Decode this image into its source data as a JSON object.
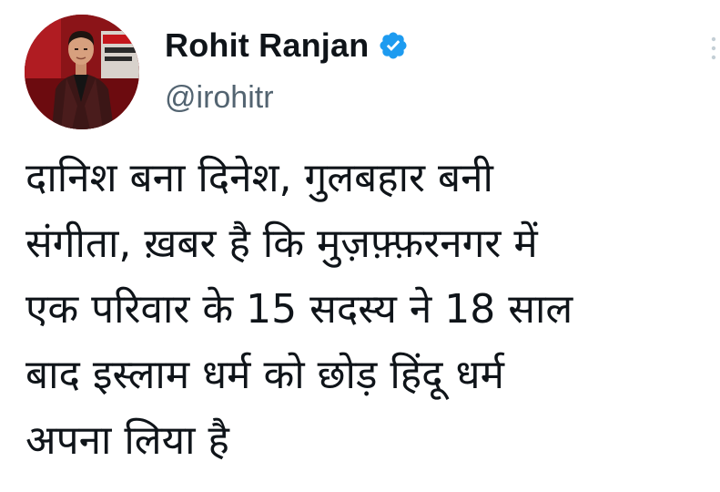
{
  "tweet": {
    "author": {
      "display_name": "Rohit Ranjan",
      "handle": "@irohitr",
      "verified": true
    },
    "text": "दानिश बना दिनेश, गुलबहार बनी\nसंगीता, ख़बर है कि मुज़फ़्फ़रनगर में\nएक परिवार के 15 सदस्य ने 18 साल\nबाद इस्लाम धर्म को छोड़ हिंदू धर्म\nअपना लिया है"
  },
  "colors": {
    "text": "#0f1419",
    "secondary_text": "#536471",
    "verified_blue": "#1d9bf0",
    "background": "#ffffff"
  },
  "icons": {
    "verified": "verified-badge-icon",
    "more": "more-options-icon"
  }
}
